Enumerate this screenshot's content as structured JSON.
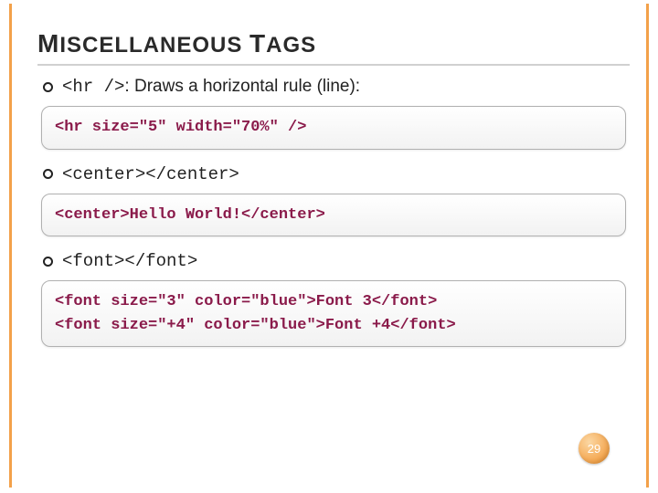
{
  "title": {
    "seg1_cap": "M",
    "seg1_rest": "ISCELLANEOUS ",
    "seg2_cap": "T",
    "seg2_rest": "AGS"
  },
  "bullets": {
    "b1_code": "<hr />",
    "b1_rest": ": Draws a horizontal rule (line):",
    "b2_code": "<center></center>",
    "b3_code": "<font></font>"
  },
  "codeboxes": {
    "c1": "<hr size=\"5\" width=\"70%\" />",
    "c2": "<center>Hello World!</center>",
    "c3": "<font size=\"3\" color=\"blue\">Font 3</font>\n<font size=\"+4\" color=\"blue\">Font +4</font>"
  },
  "page_number": "29"
}
